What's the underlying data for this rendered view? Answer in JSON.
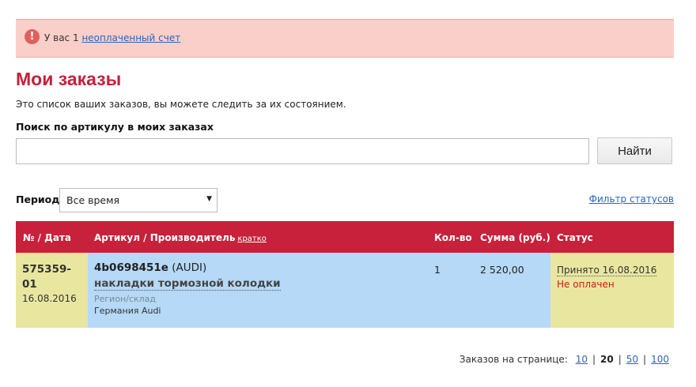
{
  "alert": {
    "icon": "exclamation-icon",
    "prefix": "У вас 1",
    "link": "неоплаченный счет"
  },
  "page": {
    "title": "Мои заказы",
    "description": "Это список ваших заказов, вы можете следить за их состоянием."
  },
  "search": {
    "label": "Поиск по артикулу в моих заказах",
    "value": "",
    "placeholder": "",
    "button": "Найти"
  },
  "period": {
    "label": "Период:",
    "selected": "Все время",
    "arrow": "▼"
  },
  "filter_link": "Фильтр статусов",
  "table": {
    "headers": {
      "number_date": "№ / Дата",
      "article": "Артикул / Производитель",
      "article_short": "кратко",
      "qty": "Кол-во",
      "sum": "Сумма (руб.)",
      "status": "Статус"
    },
    "rows": [
      {
        "order_id": "575359-01",
        "date": "16.08.2016",
        "article": "4b0698451e",
        "manufacturer": "(AUDI)",
        "name": "накладки тормозной колодки",
        "region_label": "Регион/склад",
        "region_value": "Германия Audi",
        "qty": "1",
        "sum": "2 520,00",
        "status": "Принято 16.08.2016",
        "payment": "Не оплачен"
      }
    ]
  },
  "pager": {
    "label": "Заказов на странице:",
    "options": [
      "10",
      "20",
      "50",
      "100"
    ],
    "current": "20",
    "separator": "|"
  },
  "colors": {
    "accent": "#c8213b",
    "alert_bg": "#fbcfc9",
    "row_yellow": "#e9e79f",
    "row_blue": "#b5d9f6",
    "link": "#2a64c4",
    "unpaid": "#d21919"
  }
}
